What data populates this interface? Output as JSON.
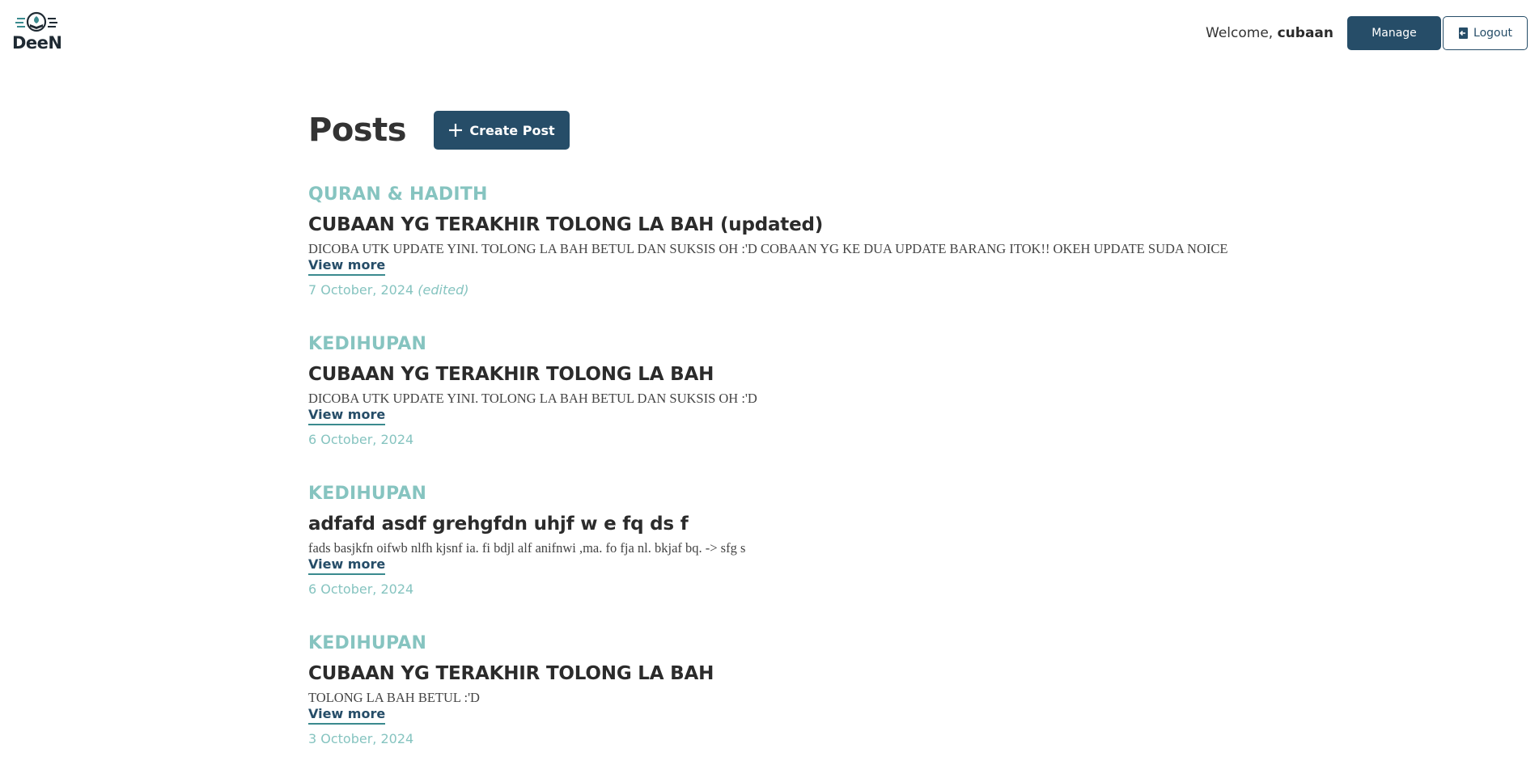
{
  "brand": {
    "name": "DeeN"
  },
  "header": {
    "welcome_prefix": "Welcome,",
    "username": "cubaan",
    "manage_label": "Manage",
    "logout_label": "Logout"
  },
  "page": {
    "title": "Posts",
    "create_label": "Create Post"
  },
  "posts": [
    {
      "category": "QURAN & HADITH",
      "title": "CUBAAN YG TERAKHIR TOLONG LA BAH (updated)",
      "excerpt": "DICOBA UTK UPDATE YINI. TOLONG LA BAH BETUL DAN SUKSIS OH :'D COBAAN YG KE DUA UPDATE BARANG ITOK!! OKEH UPDATE SUDA NOICE",
      "view_more": "View more",
      "date": "7 October, 2024",
      "edited": "(edited)"
    },
    {
      "category": "KEDIHUPAN",
      "title": "CUBAAN YG TERAKHIR TOLONG LA BAH",
      "excerpt": "DICOBA UTK UPDATE YINI. TOLONG LA BAH BETUL DAN SUKSIS OH :'D",
      "view_more": "View more",
      "date": "6 October, 2024",
      "edited": ""
    },
    {
      "category": "KEDIHUPAN",
      "title": "adfafd asdf grehgfdn uhjf w e fq ds f",
      "excerpt": "fads basjkfn oifwb nlfh kjsnf ia. fi bdjl alf anifnwi ,ma. fo fja nl. bkjaf bq. -> sfg s",
      "view_more": "View more",
      "date": "6 October, 2024",
      "edited": ""
    },
    {
      "category": "KEDIHUPAN",
      "title": "CUBAAN YG TERAKHIR TOLONG LA BAH",
      "excerpt": "TOLONG LA BAH BETUL :'D",
      "view_more": "View more",
      "date": "3 October, 2024",
      "edited": ""
    }
  ],
  "colors": {
    "primary": "#264d68",
    "accent": "#86c4c0",
    "text": "#2b2b2b"
  },
  "icons": {
    "logo": "book-sprout-logo-icon",
    "create": "plus-icon",
    "logout": "logout-icon"
  }
}
